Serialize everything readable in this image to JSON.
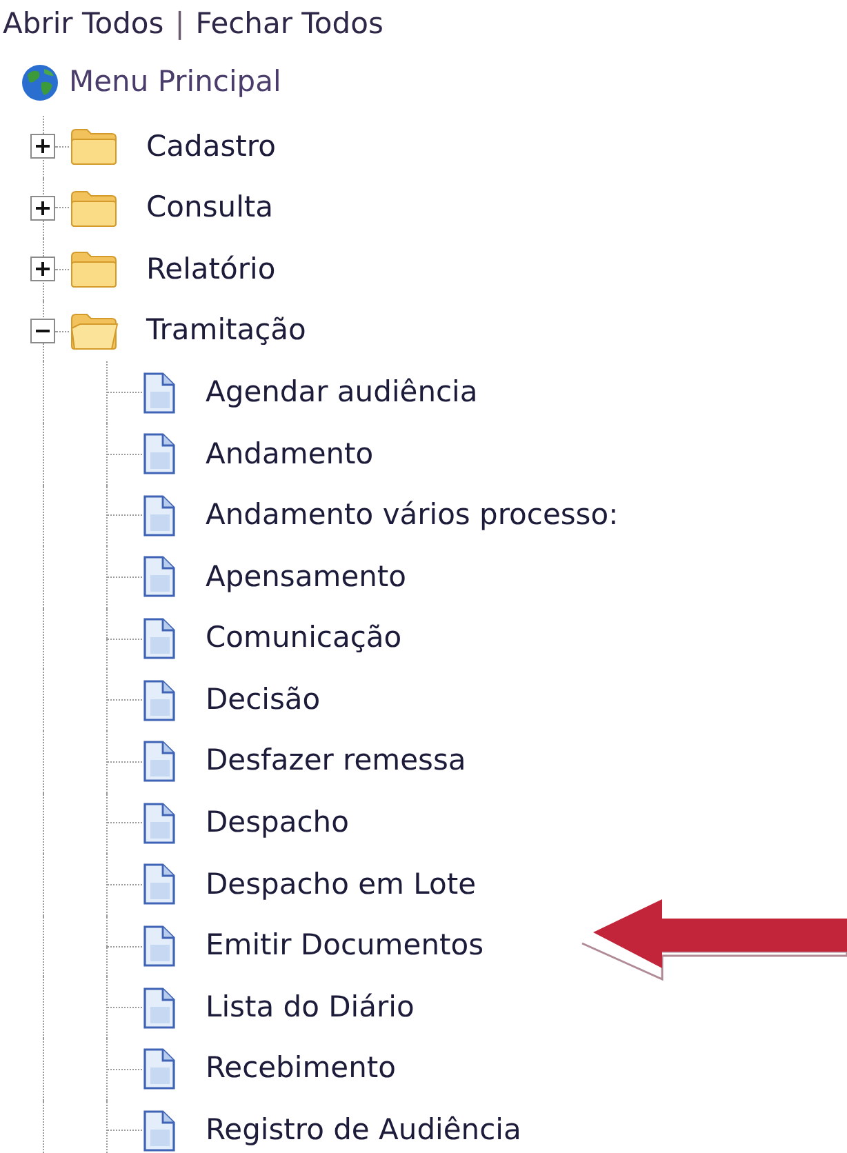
{
  "links": [
    {
      "label": "Abrir Todos"
    },
    {
      "label": "|"
    },
    {
      "label": "Fechar Todos"
    }
  ],
  "tree": {
    "label": "Menu Principal",
    "children": [
      {
        "label": "Cadastro",
        "expanded": false
      },
      {
        "label": "Consulta",
        "expanded": false
      },
      {
        "label": "Relatório",
        "expanded": false
      },
      {
        "label": "Tramitação",
        "expanded": true,
        "children": [
          {
            "label": "Agendar audiência",
            "marked": false
          },
          {
            "label": "Andamento",
            "marked": false
          },
          {
            "label": "Andamento vários processo:",
            "marked": false
          },
          {
            "label": "Apensamento",
            "marked": false
          },
          {
            "label": "Comunicação",
            "marked": false
          },
          {
            "label": "Decisão",
            "marked": false
          },
          {
            "label": "Desfazer remessa",
            "marked": false
          },
          {
            "label": "Despacho",
            "marked": false
          },
          {
            "label": "Despacho em Lote",
            "marked": false
          },
          {
            "label": "Emitir Documentos",
            "marked": true
          },
          {
            "label": "Lista do Diário",
            "marked": false
          },
          {
            "label": "Recebimento",
            "marked": false
          },
          {
            "label": "Registro de Audiência",
            "marked": false
          }
        ]
      }
    ]
  }
}
